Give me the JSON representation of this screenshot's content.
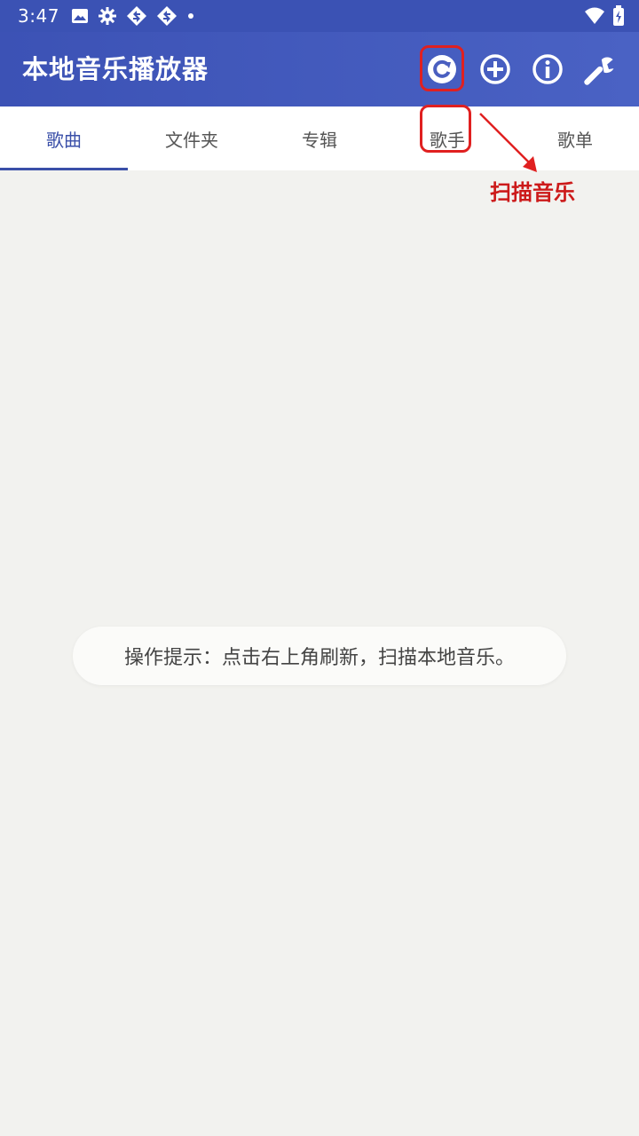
{
  "status_bar": {
    "time": "3:47",
    "left_icons": [
      "image-icon",
      "gear-icon",
      "sync-icon",
      "sync-icon",
      "dot-icon"
    ],
    "right_icons": [
      "wifi-icon",
      "battery-icon"
    ]
  },
  "app_bar": {
    "title": "本地音乐播放器",
    "actions": [
      "refresh-icon",
      "add-circle-icon",
      "info-icon",
      "wrench-icon"
    ],
    "color": "#3c52b5"
  },
  "tabs": [
    {
      "label": "歌曲",
      "active": true
    },
    {
      "label": "文件夹",
      "active": false
    },
    {
      "label": "专辑",
      "active": false
    },
    {
      "label": "歌手",
      "active": false
    },
    {
      "label": "歌单",
      "active": false
    }
  ],
  "toast": {
    "text": "操作提示：点击右上角刷新，扫描本地音乐。"
  },
  "annotation": {
    "label": "扫描音乐",
    "color": "#e02020"
  }
}
